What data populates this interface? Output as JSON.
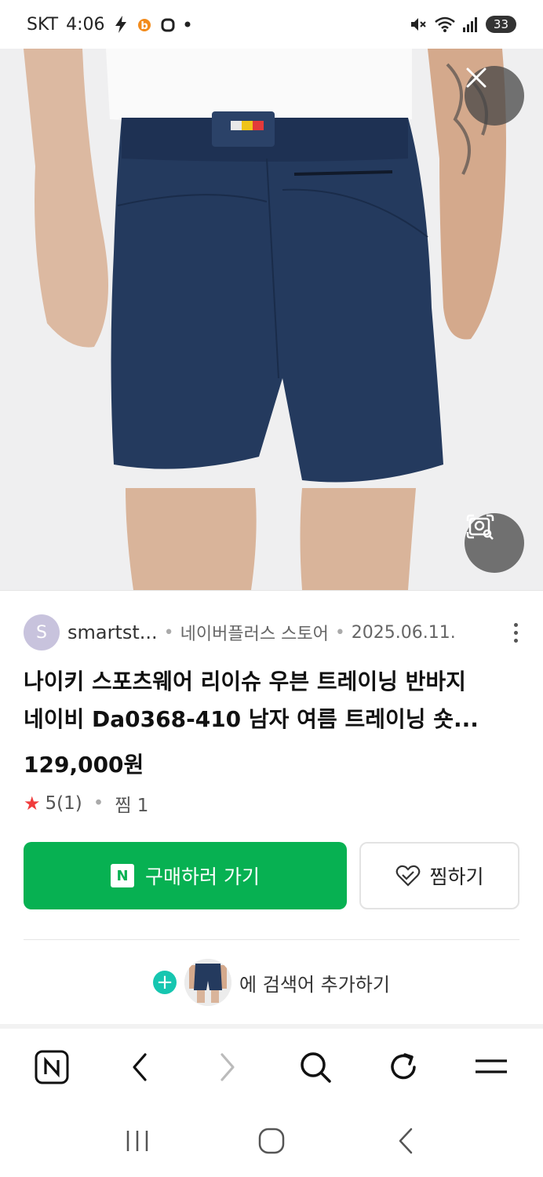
{
  "status_bar": {
    "carrier": "SKT",
    "time": "4:06",
    "battery": "33"
  },
  "product": {
    "source_initial": "S",
    "source_name": "smartst...",
    "store": "네이버플러스 스토어",
    "date": "2025.06.11.",
    "title_line1": "나이키 스포츠웨어 리이슈 우븐 트레이닝 반바지",
    "title_line2": "네이비 Da0368-410 남자 여름 트레이닝 숏...",
    "price": "129,000원",
    "rating": "5(1)",
    "wishes": "찜 1"
  },
  "actions": {
    "buy_label": "구매하러 가기",
    "buy_badge": "N",
    "wish_label": "찜하기",
    "add_search_label": "에 검색어 추가하기"
  },
  "colors": {
    "buy_green": "#07b152",
    "star_red": "#f03c3c",
    "plus_teal": "#16c6b0",
    "shorts_navy": "#243a5e"
  },
  "icons": {
    "close": "close-icon",
    "lens": "image-search-icon",
    "more": "more-vertical-icon",
    "heart": "heart-icon",
    "plus": "plus-icon",
    "naver": "naver-home-icon",
    "back": "back-icon",
    "forward": "forward-icon",
    "search": "search-icon",
    "refresh": "refresh-icon",
    "menu": "menu-icon"
  }
}
